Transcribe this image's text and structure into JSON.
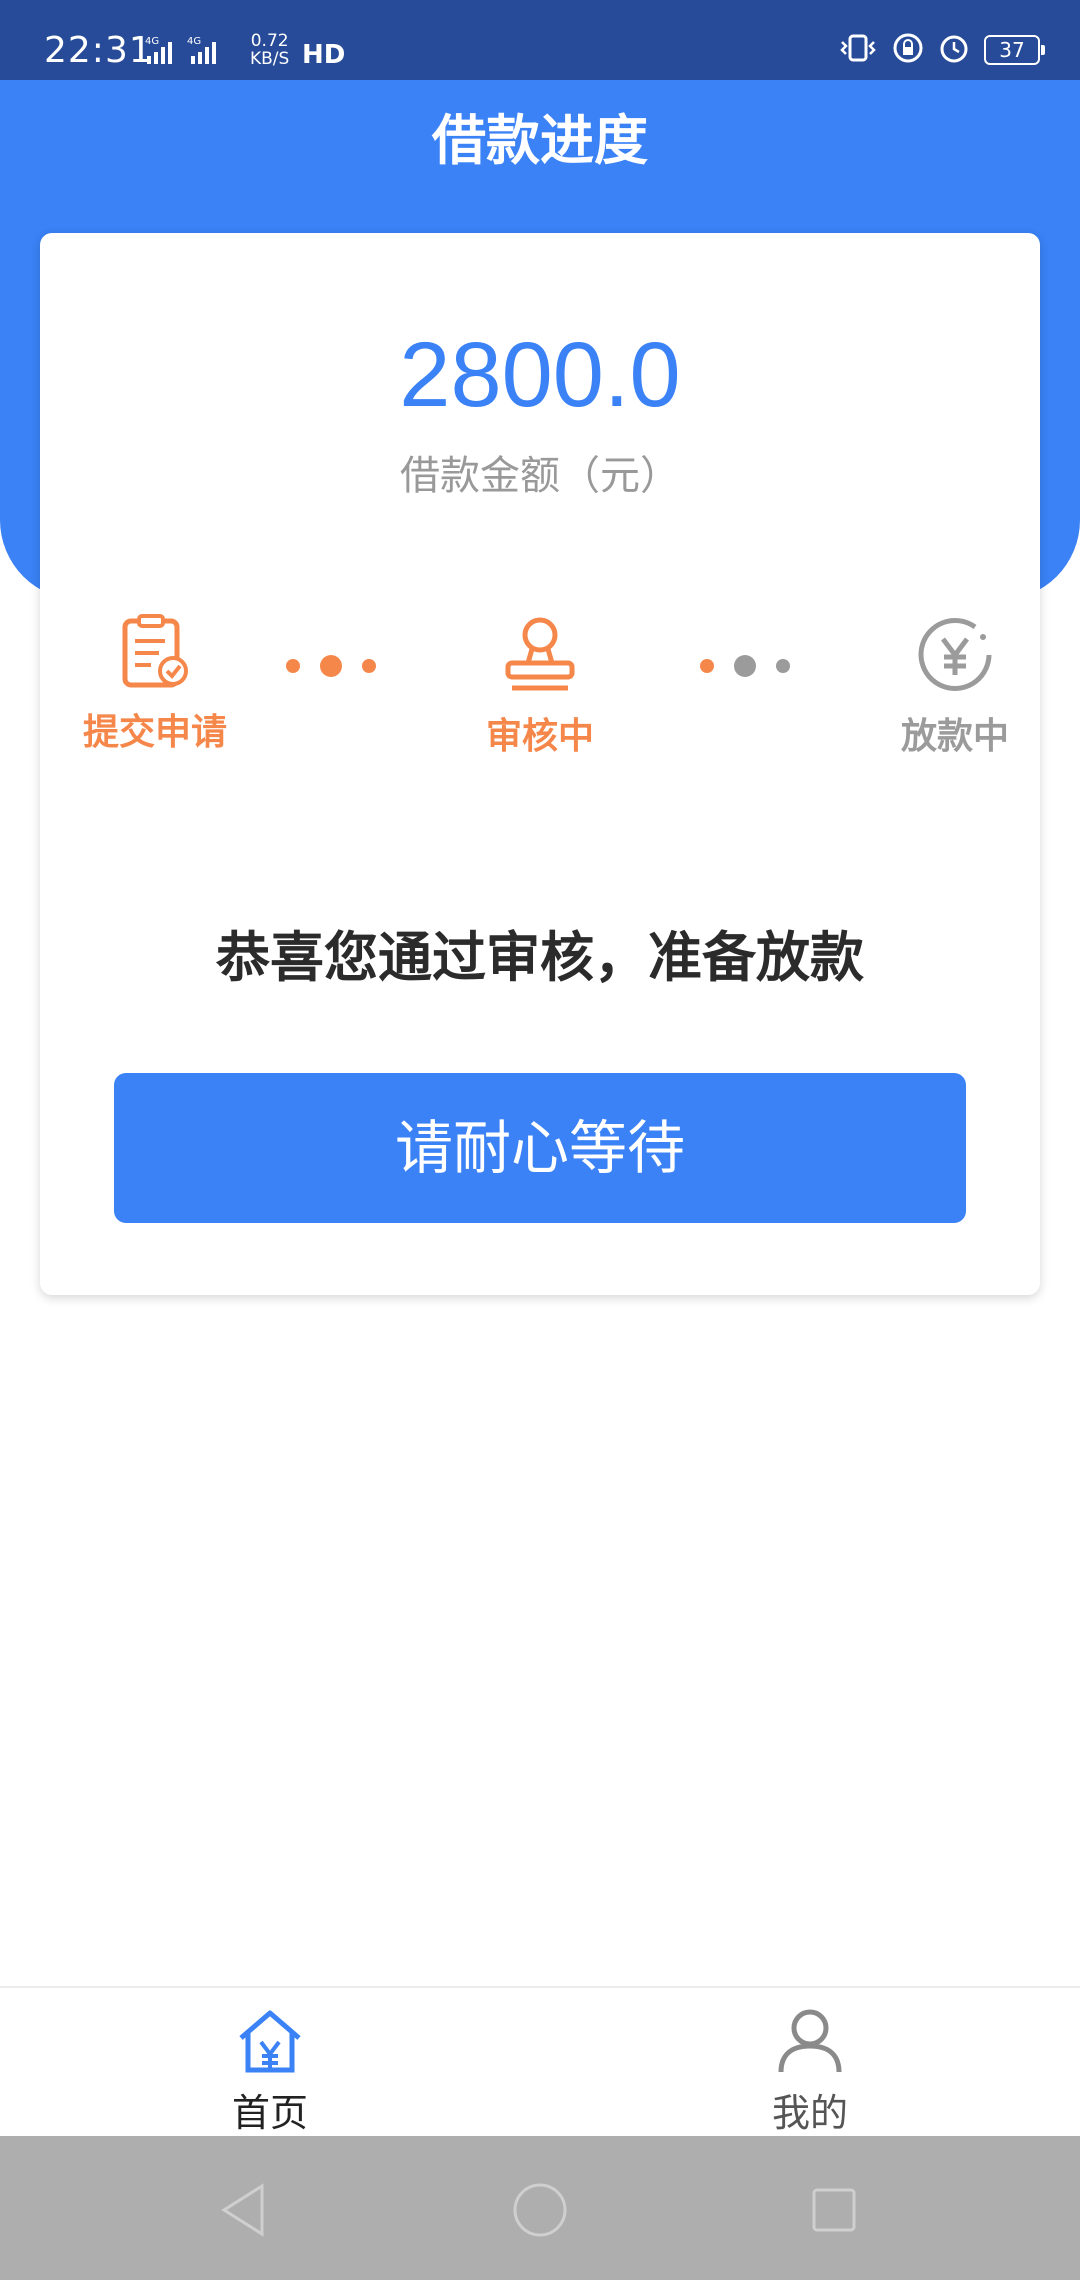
{
  "status_bar": {
    "time": "22:31",
    "net_speed_value": "0.72",
    "net_speed_unit": "KB/S",
    "hd": "HD",
    "battery": "37"
  },
  "header": {
    "title": "借款进度"
  },
  "loan": {
    "amount": "2800.0",
    "amount_label": "借款金额（元）"
  },
  "steps": [
    {
      "label": "提交申请",
      "state": "done",
      "icon": "document-check-icon"
    },
    {
      "label": "审核中",
      "state": "active",
      "icon": "stamp-icon"
    },
    {
      "label": "放款中",
      "state": "pending",
      "icon": "yen-coin-icon"
    }
  ],
  "message": "恭喜您通过审核，准备放款",
  "action_button": {
    "label": "请耐心等待"
  },
  "bottom_nav": [
    {
      "label": "首页",
      "icon": "home-yen-icon",
      "active": true
    },
    {
      "label": "我的",
      "icon": "user-icon",
      "active": false
    }
  ],
  "colors": {
    "primary": "#3a82f6",
    "accent_orange": "#f5874a",
    "inactive_grey": "#9b9b9b",
    "status_bar": "#274b98"
  }
}
